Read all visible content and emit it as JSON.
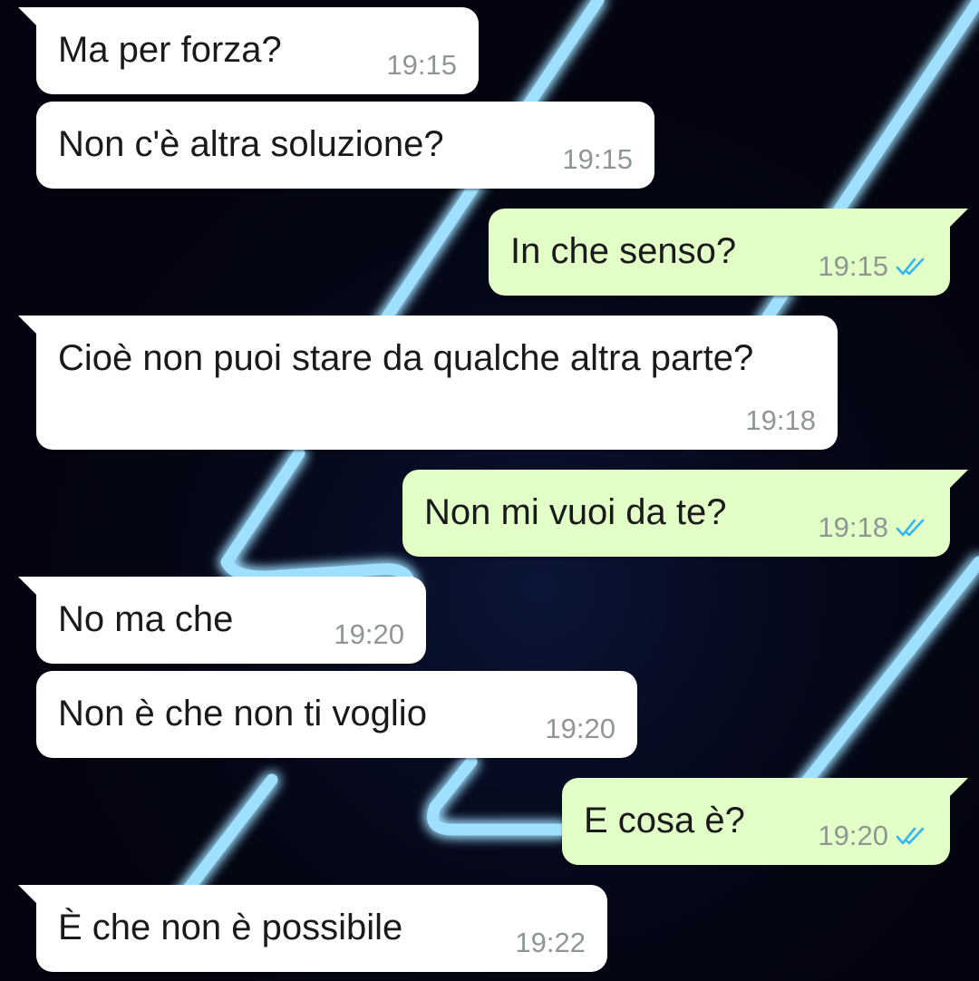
{
  "theme": {
    "incoming_bg": "#ffffff",
    "outgoing_bg": "#e2ffc8",
    "time_color": "#8f9793",
    "read_check_color": "#34b7f1",
    "wallpaper_bg": "#03040f",
    "wallpaper_neon": "#9fe0ff"
  },
  "messages": [
    {
      "direction": "incoming",
      "text": "Ma per forza?",
      "time": "19:15"
    },
    {
      "direction": "incoming",
      "text": "Non c'è altra soluzione?",
      "time": "19:15"
    },
    {
      "direction": "outgoing",
      "text": "In che senso?",
      "time": "19:15",
      "status": "read-double-check-icon"
    },
    {
      "direction": "incoming",
      "text": "Cioè non puoi stare da qualche altra parte?",
      "time": "19:18"
    },
    {
      "direction": "outgoing",
      "text": "Non mi vuoi da te?",
      "time": "19:18",
      "status": "read-double-check-icon"
    },
    {
      "direction": "incoming",
      "text": "No ma che",
      "time": "19:20"
    },
    {
      "direction": "incoming",
      "text": "Non è che non ti voglio",
      "time": "19:20"
    },
    {
      "direction": "outgoing",
      "text": "E cosa è?",
      "time": "19:20",
      "status": "read-double-check-icon"
    },
    {
      "direction": "incoming",
      "text": "È che non è possibile",
      "time": "19:22"
    }
  ]
}
